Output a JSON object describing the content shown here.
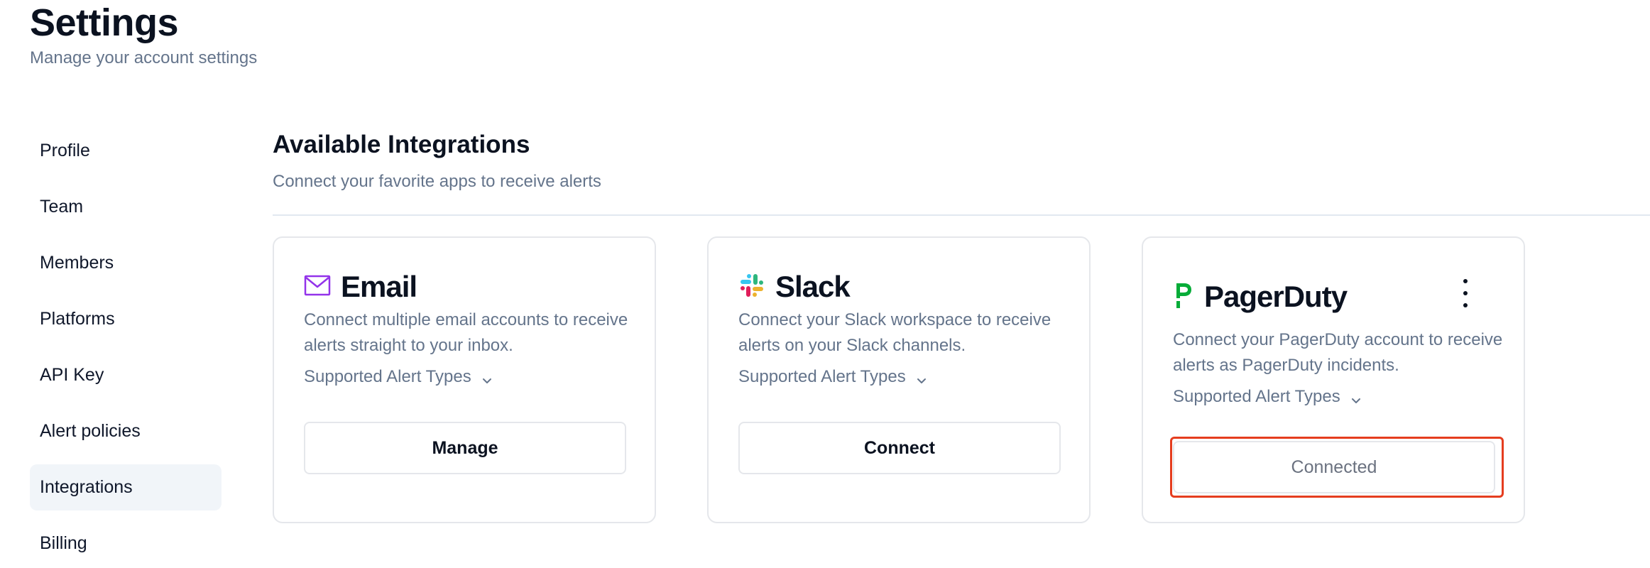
{
  "header": {
    "title": "Settings",
    "subtitle": "Manage your account settings"
  },
  "sidebar": {
    "items": [
      {
        "label": "Profile"
      },
      {
        "label": "Team"
      },
      {
        "label": "Members"
      },
      {
        "label": "Platforms"
      },
      {
        "label": "API Key"
      },
      {
        "label": "Alert policies"
      },
      {
        "label": "Integrations",
        "active": true
      },
      {
        "label": "Billing"
      }
    ]
  },
  "main": {
    "title": "Available Integrations",
    "subtitle": "Connect your favorite apps to receive alerts"
  },
  "integrations": [
    {
      "name": "Email",
      "icon": "envelope-icon",
      "description": "Connect multiple email accounts to receive alerts straight to your inbox.",
      "alert_types_label": "Supported Alert Types",
      "button_label": "Manage"
    },
    {
      "name": "Slack",
      "icon": "slack-logo-icon",
      "description": "Connect your Slack workspace to receive alerts on your Slack channels.",
      "alert_types_label": "Supported Alert Types",
      "button_label": "Connect"
    },
    {
      "name": "PagerDuty",
      "icon": "pagerduty-logo-icon",
      "description": "Connect your PagerDuty account to receive alerts as PagerDuty incidents.",
      "alert_types_label": "Supported Alert Types",
      "button_label": "Connected",
      "status": "connected"
    }
  ],
  "colors": {
    "email_icon": "#9333ea",
    "pagerduty_brand": "#06ac38",
    "highlight": "#e53d1f",
    "active_bg": "#f1f5f9",
    "muted_text": "#64748b"
  }
}
